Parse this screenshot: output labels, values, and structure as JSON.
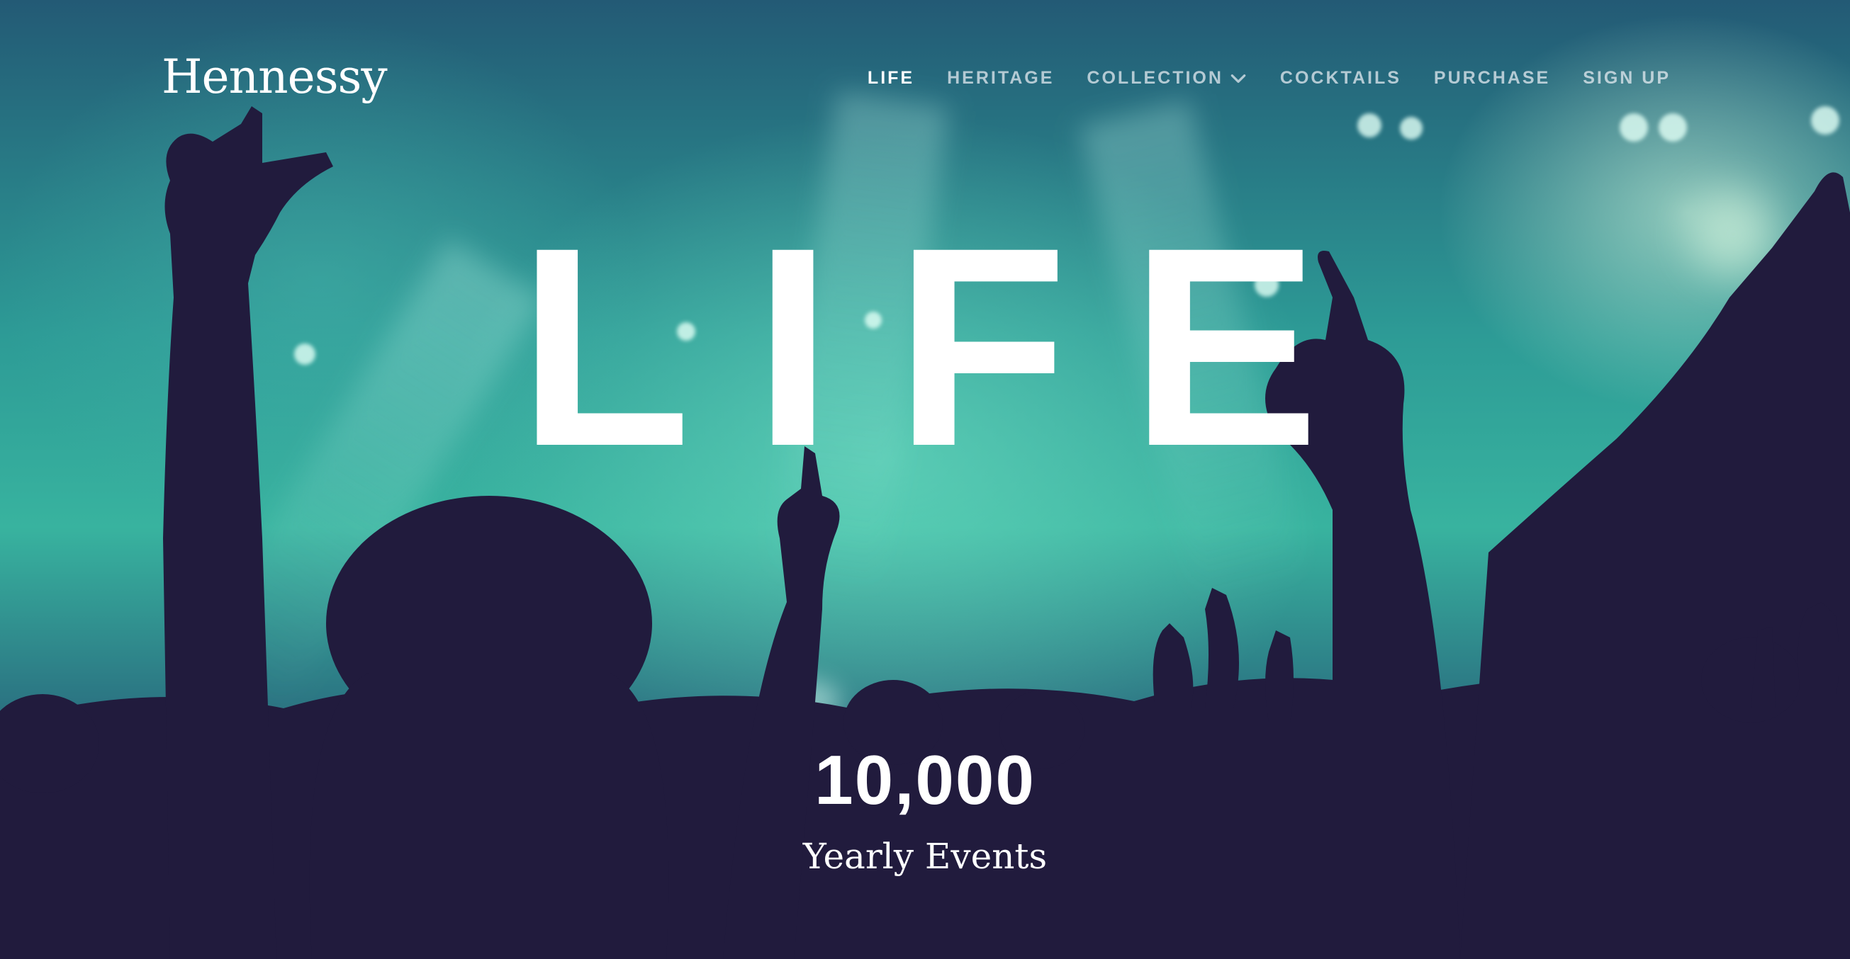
{
  "brand": {
    "logo_text": "Hennessy"
  },
  "nav": {
    "items": [
      {
        "label": "LIFE",
        "active": true
      },
      {
        "label": "HERITAGE",
        "active": false
      },
      {
        "label": "COLLECTION",
        "active": false,
        "icon": "chevron-down-icon"
      },
      {
        "label": "COCKTAILS",
        "active": false
      },
      {
        "label": "PURCHASE",
        "active": false
      },
      {
        "label": "SIGN UP",
        "active": false
      }
    ]
  },
  "hero": {
    "headline": "LIFE",
    "stat_value": "10,000",
    "stat_label": "Yearly Events",
    "background": "concert crowd silhouettes with teal stage lights"
  },
  "colors": {
    "teal": "#38b39f",
    "dark_navy": "#211b3d",
    "text_white": "#ffffff"
  }
}
